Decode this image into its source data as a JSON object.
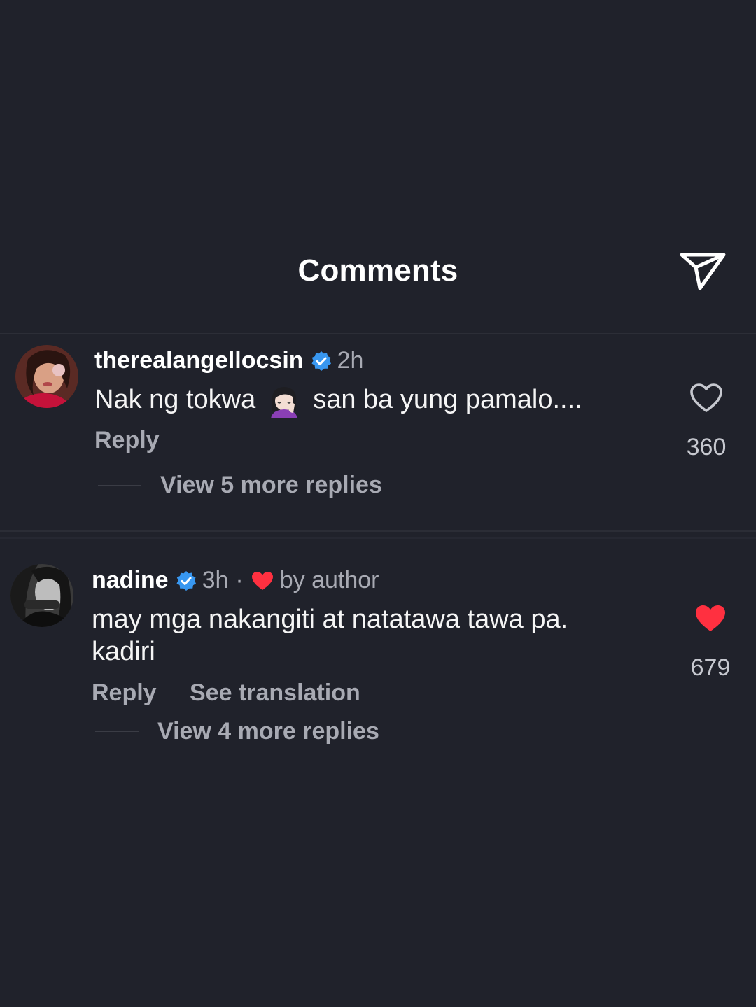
{
  "header": {
    "title": "Comments",
    "share_icon": "send-icon"
  },
  "comments": [
    {
      "username": "therealangellocsin",
      "verified": true,
      "time": "2h",
      "text_part1": "Nak ng tokwa",
      "emoji": "woman-facepalming-emoji",
      "text_part2": "san ba yung pamalo....",
      "reply_label": "Reply",
      "view_replies": "View 5 more replies",
      "like_count": "360",
      "liked": false
    },
    {
      "username": "nadine",
      "verified": true,
      "time": "3h",
      "separator": "·",
      "by_author": "by author",
      "text_line1": "may mga nakangiti at natatawa tawa pa.",
      "text_line2": "kadiri",
      "reply_label": "Reply",
      "see_translation": "See translation",
      "view_replies": "View 4 more replies",
      "like_count": "679",
      "liked": true
    }
  ],
  "colors": {
    "background": "#20222b",
    "verified_blue": "#3897f0",
    "like_red": "#ff3040",
    "secondary_text": "#a8aab3"
  }
}
